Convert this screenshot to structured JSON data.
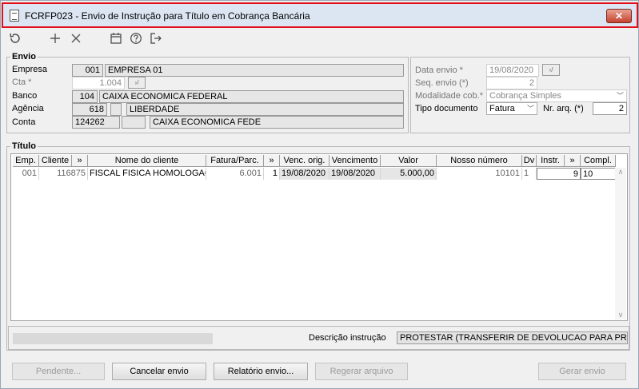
{
  "window": {
    "title": "FCRFP023 - Envio de Instrução para Título em Cobrança Bancária",
    "close_label": "✕"
  },
  "toolbar": {
    "refresh_icon": "refresh-icon",
    "add_icon": "plus-icon",
    "remove_icon": "close-icon",
    "calendar_icon": "calendar-icon",
    "help_icon": "help-icon",
    "exit_icon": "exit-icon"
  },
  "envio": {
    "section_label": "Envio",
    "empresa_label": "Empresa",
    "empresa_code": "001",
    "empresa_name": "EMPRESA 01",
    "cta_label": "Cta *",
    "cta_value": "1.004",
    "banco_label": "Banco",
    "banco_code": "104",
    "banco_name": "CAIXA ECONOMICA FEDERAL",
    "agencia_label": "Agência",
    "agencia_code": "618",
    "agencia_digit": "",
    "agencia_name": "LIBERDADE",
    "conta_label": "Conta",
    "conta_number": "124262",
    "conta_digit": "",
    "conta_name": "CAIXA ECONOMICA FEDE"
  },
  "envio_right": {
    "data_envio_label": "Data envio *",
    "data_envio_value": "19/08/2020",
    "seq_label": "Seq. envio (*)",
    "seq_value": "2",
    "modalidade_label": "Modalidade cob.*",
    "modalidade_value": "Cobrança Simples",
    "tipo_label": "Tipo documento",
    "tipo_value": "Fatura",
    "nr_arq_label": "Nr. arq. (*)",
    "nr_arq_value": "2"
  },
  "titulo": {
    "section_label": "Título",
    "columns": [
      "Emp.",
      "Cliente",
      "»",
      "Nome do cliente",
      "Fatura/Parc.",
      "»",
      "Venc. orig.",
      "Vencimento",
      "Valor",
      "Nosso número",
      "Dv",
      "Instr.",
      "»",
      "Compl."
    ],
    "rows": [
      [
        "001",
        "116875",
        "FISCAL FISICA HOMOLOGACAO",
        "6.001",
        "1",
        "19/08/2020",
        "19/08/2020",
        "5.000,00",
        "10101",
        "1",
        "9",
        "10"
      ]
    ]
  },
  "status": {
    "descricao_label": "Descrição instrução",
    "descricao_value": "PROTESTAR (TRANSFERIR DE DEVOLUCAO PARA PROTESTO)"
  },
  "buttons": {
    "pendente": "Pendente...",
    "cancelar": "Cancelar envio",
    "relatorio": "Relatório envio...",
    "regerar": "Regerar arquivo",
    "gerar": "Gerar envio"
  }
}
